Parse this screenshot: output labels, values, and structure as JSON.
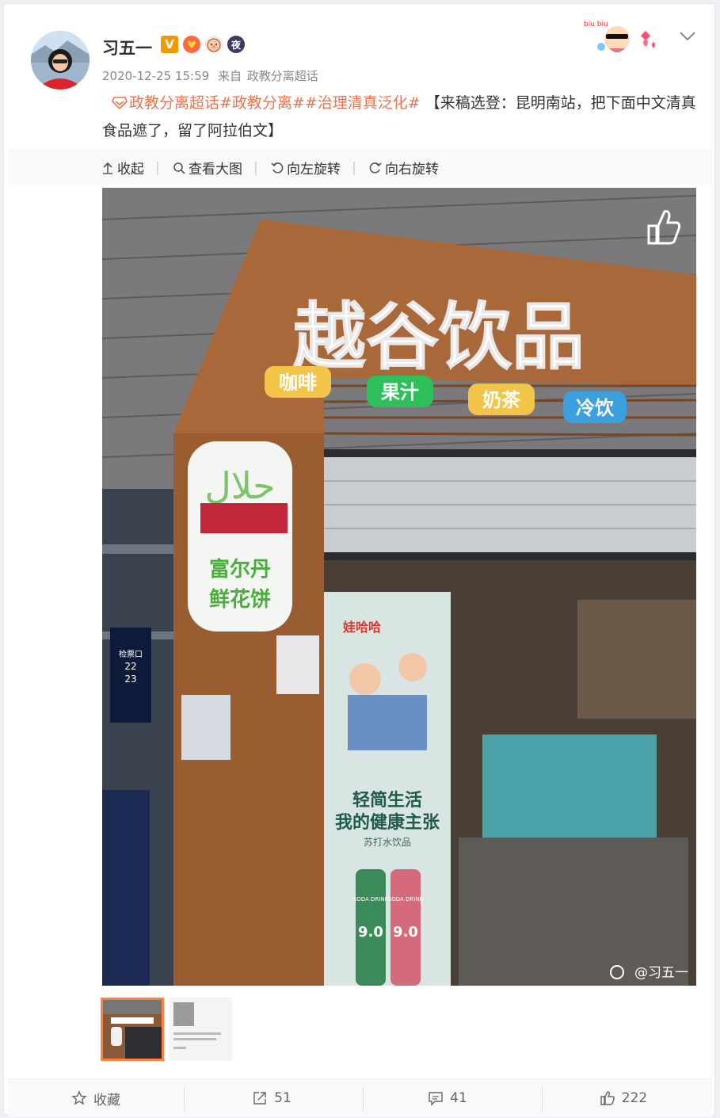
{
  "header": {
    "username": "习五一",
    "badges": {
      "verified": "V",
      "night": "夜"
    },
    "timestamp": "2020-12-25 15:59",
    "source_prefix": "来自",
    "source": "政教分离超话"
  },
  "post": {
    "topic_1": "政教分离超话",
    "topic_2": "#政教分离#",
    "topic_3": "#治理清真泛化#",
    "body": "【来稿选登：昆明南站，把下面中文清真食品遮了，留了阿拉伯文】"
  },
  "toolbar": {
    "collapse": "收起",
    "view_large": "查看大图",
    "rotate_left": "向左旋转",
    "rotate_right": "向右旋转"
  },
  "photo": {
    "store_sign": "越谷饮品",
    "menu_tags": [
      "咖啡",
      "果汁",
      "奶茶",
      "冷饮"
    ],
    "halal_arabic": "حلال",
    "halal_cn_1": "富尔丹",
    "halal_cn_2": "鲜花饼",
    "poster_brand": "娃哈哈",
    "poster_slogan_1": "轻简生活",
    "poster_slogan_2": "我的健康主张",
    "poster_sub": "苏打水饮品",
    "bottle_label": "SODA DRINK",
    "bottle_ph": "9.0",
    "gate_label": "检票口",
    "gate_nums": [
      "22",
      "23"
    ],
    "watermark": "@习五一"
  },
  "footer": {
    "favorite": "收藏",
    "repost_count": "51",
    "comment_count": "41",
    "like_count": "222"
  },
  "colors": {
    "topic": "#eb7350",
    "accent_orange": "#ff8140",
    "verified_orange": "#f39800"
  }
}
